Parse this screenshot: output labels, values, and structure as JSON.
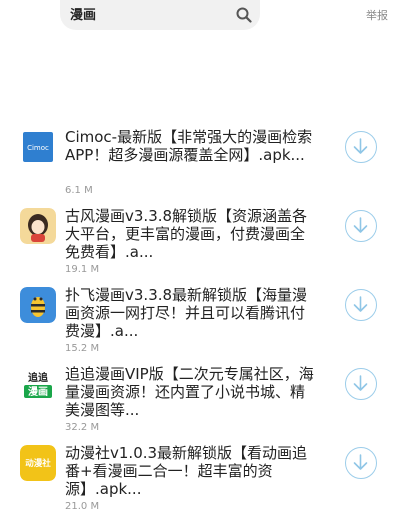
{
  "search": {
    "value": "漫画"
  },
  "header": {
    "report_label": "举报"
  },
  "results": [
    {
      "title": "Cimoc-最新版【非常强大的漫画检索APP！超多漫画源覆盖全网】.apk...",
      "size": "6.1 M",
      "icon": "cimoc-app-icon",
      "icon_text": "Cimoc",
      "color": "#2f7fd0"
    },
    {
      "title": "古风漫画v3.3.8解锁版【资源涵盖各大平台，更丰富的漫画，付费漫画全免费看】.a...",
      "size": "19.1 M",
      "icon": "gufeng-manga-app-icon",
      "color": "#f4d99a"
    },
    {
      "title": "扑飞漫画v3.3.8最新解锁版【海量漫画资源一网打尽！并且可以看腾讯付费漫】.a...",
      "size": "15.2 M",
      "icon": "pufei-manga-app-icon",
      "color": "#3d8ddb"
    },
    {
      "title": "追追漫画VIP版【二次元专属社区，海量漫画资源！还内置了小说书城、精美漫图等...",
      "size": "32.2 M",
      "icon": "zhuizhui-manga-app-icon",
      "icon_text": "追追",
      "icon_text2": "漫画",
      "color": "#1aa64a"
    },
    {
      "title": "动漫社v1.0.3最新解锁版【看动画追番+看漫画二合一！超丰富的资源】.apk...",
      "size": "21.0 M",
      "icon": "dongmanshe-app-icon",
      "icon_text": "动漫社",
      "color": "#f2c318"
    }
  ]
}
